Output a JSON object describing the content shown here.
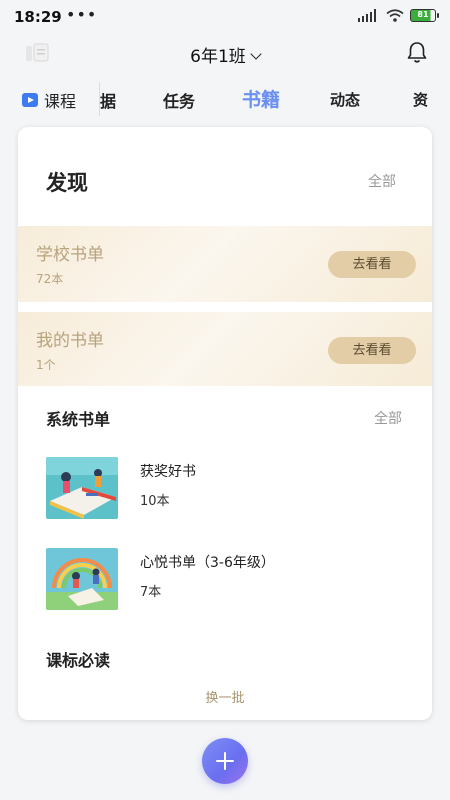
{
  "status_bar": {
    "time": "18:29",
    "dots": "•••",
    "battery": "81",
    "battery_color": "#3aae3a"
  },
  "header": {
    "class_name": "6年1班",
    "left_icon": "app-logo-icon",
    "right_icon": "bell-icon"
  },
  "tabs": [
    {
      "label": "课程",
      "icon": "play-icon"
    },
    {
      "label": "据"
    },
    {
      "label": "任务"
    },
    {
      "label": "书籍",
      "active": true
    },
    {
      "label": "动态"
    },
    {
      "label": "资"
    }
  ],
  "accent_color": "#6a8ff2",
  "discover": {
    "title": "发现",
    "all_label": "全部",
    "school_list": {
      "title": "学校书单",
      "count": "72本",
      "button": "去看看"
    },
    "my_list": {
      "title": "我的书单",
      "count": "1个",
      "button": "去看看"
    }
  },
  "system_lists": {
    "title": "系统书单",
    "all_label": "全部",
    "items": [
      {
        "name": "获奖好书",
        "count": "10本"
      },
      {
        "name": "心悦书单（3-6年级）",
        "count": "7本"
      }
    ]
  },
  "curriculum": {
    "title": "课标必读",
    "refresh_label": "换一批"
  },
  "fab": {
    "icon": "plus-icon"
  }
}
